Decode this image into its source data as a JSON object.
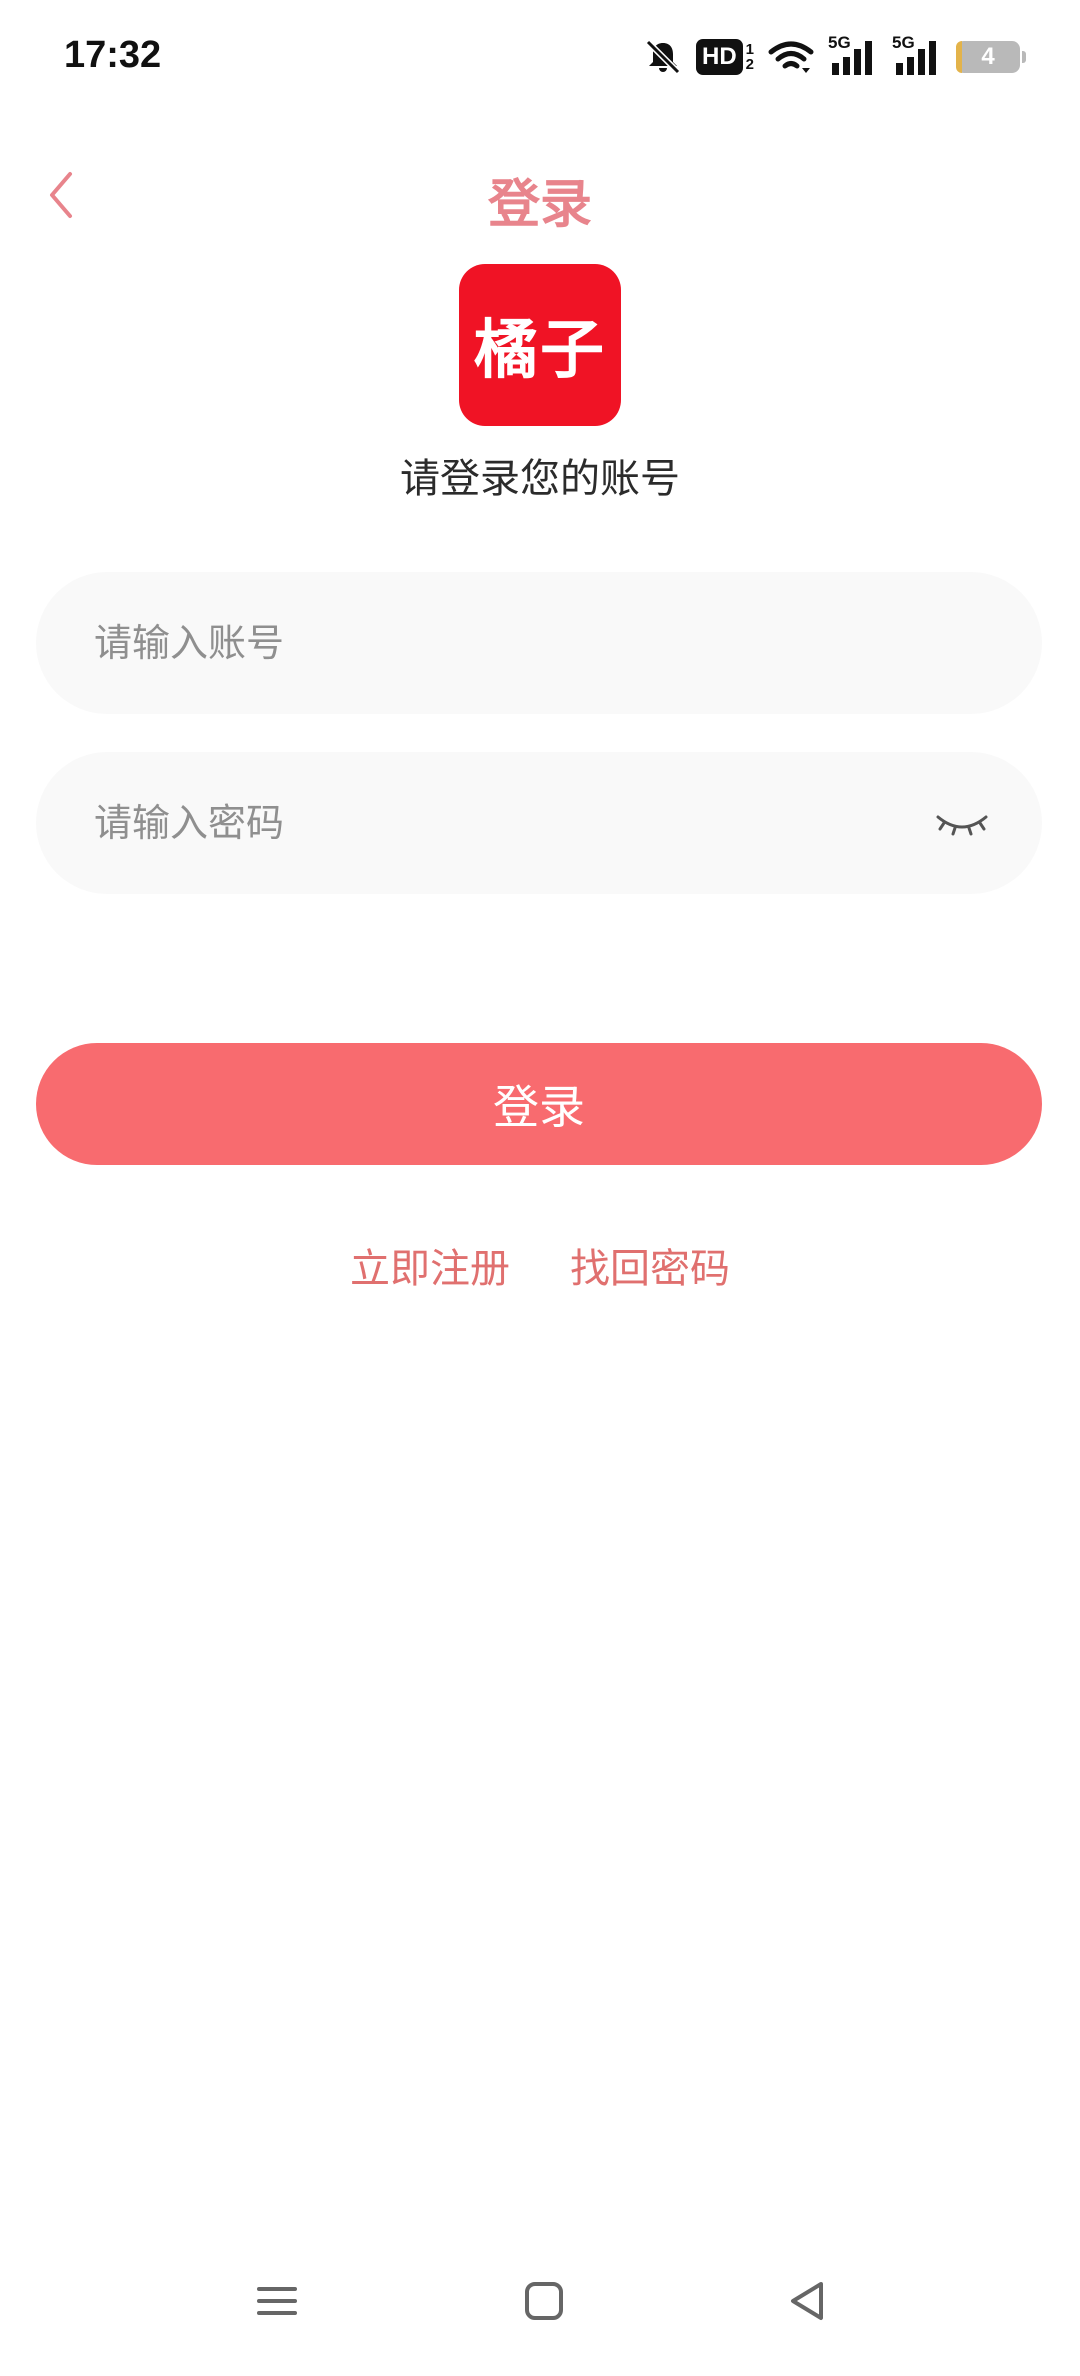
{
  "status_bar": {
    "time": "17:32",
    "icons": [
      "bell-off-icon",
      "hd-icon",
      "wifi-icon",
      "signal-5g-icon",
      "signal-5g-icon",
      "battery-icon"
    ],
    "hd_label": "HD",
    "hd_sub_top": "1",
    "hd_sub_bottom": "2",
    "network_label": "5G",
    "battery_level": "4"
  },
  "header": {
    "title": "登录",
    "back_icon": "chevron-left-icon"
  },
  "logo": {
    "text": "橘子",
    "color": "#f01325"
  },
  "subtitle": "请登录您的账号",
  "form": {
    "account_placeholder": "请输入账号",
    "account_value": "",
    "password_placeholder": "请输入密码",
    "password_value": "",
    "password_toggle_icon": "eye-closed-icon"
  },
  "login_button": "登录",
  "links": {
    "register": "立即注册",
    "recover_password": "找回密码"
  },
  "nav_bar": {
    "icons": [
      "menu-icon",
      "home-icon",
      "back-triangle-icon"
    ]
  },
  "colors": {
    "accent": "#f86b6f",
    "title": "#e8848c",
    "link": "#e0706f",
    "input_bg": "#f9f9f9"
  }
}
